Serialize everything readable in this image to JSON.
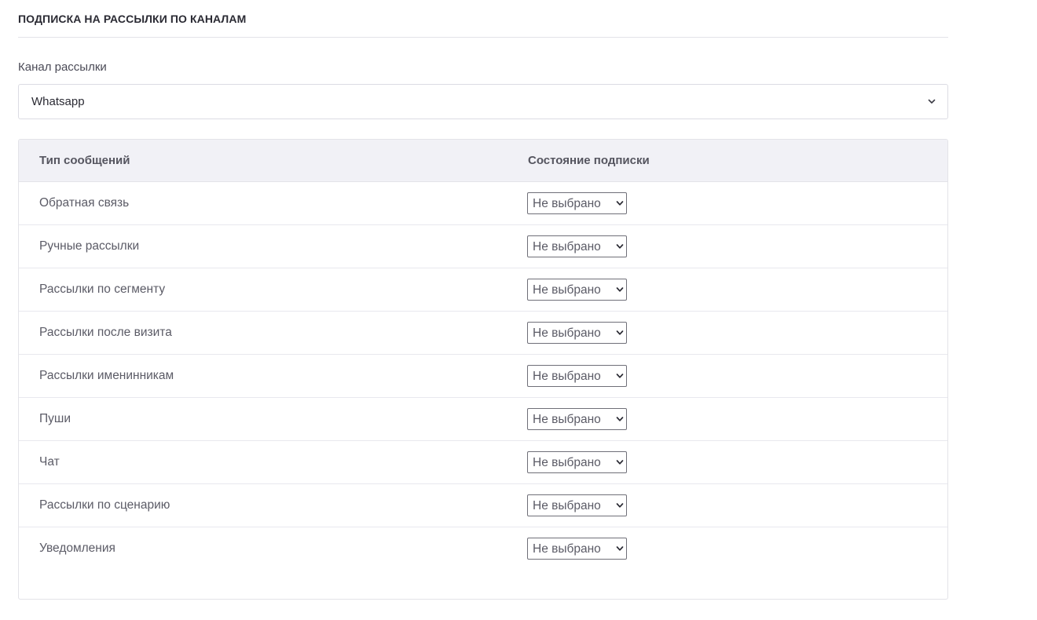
{
  "section": {
    "title": "ПОДПИСКА НА РАССЫЛКИ ПО КАНАЛАМ"
  },
  "channel": {
    "label": "Канал рассылки",
    "value": "Whatsapp"
  },
  "table": {
    "headers": {
      "type": "Тип сообщений",
      "state": "Состояние подписки"
    },
    "rows": [
      {
        "type": "Обратная связь",
        "state": "Не выбрано"
      },
      {
        "type": "Ручные рассылки",
        "state": "Не выбрано"
      },
      {
        "type": "Рассылки по сегменту",
        "state": "Не выбрано"
      },
      {
        "type": "Рассылки после визита",
        "state": "Не выбрано"
      },
      {
        "type": "Рассылки именинникам",
        "state": "Не выбрано"
      },
      {
        "type": "Пуши",
        "state": "Не выбрано"
      },
      {
        "type": "Чат",
        "state": "Не выбрано"
      },
      {
        "type": "Рассылки по сценарию",
        "state": "Не выбрано"
      },
      {
        "type": "Уведомления",
        "state": "Не выбрано"
      }
    ]
  },
  "icons": {
    "channel_select": "chevron-down-icon",
    "row_select": "chevron-down-icon"
  }
}
